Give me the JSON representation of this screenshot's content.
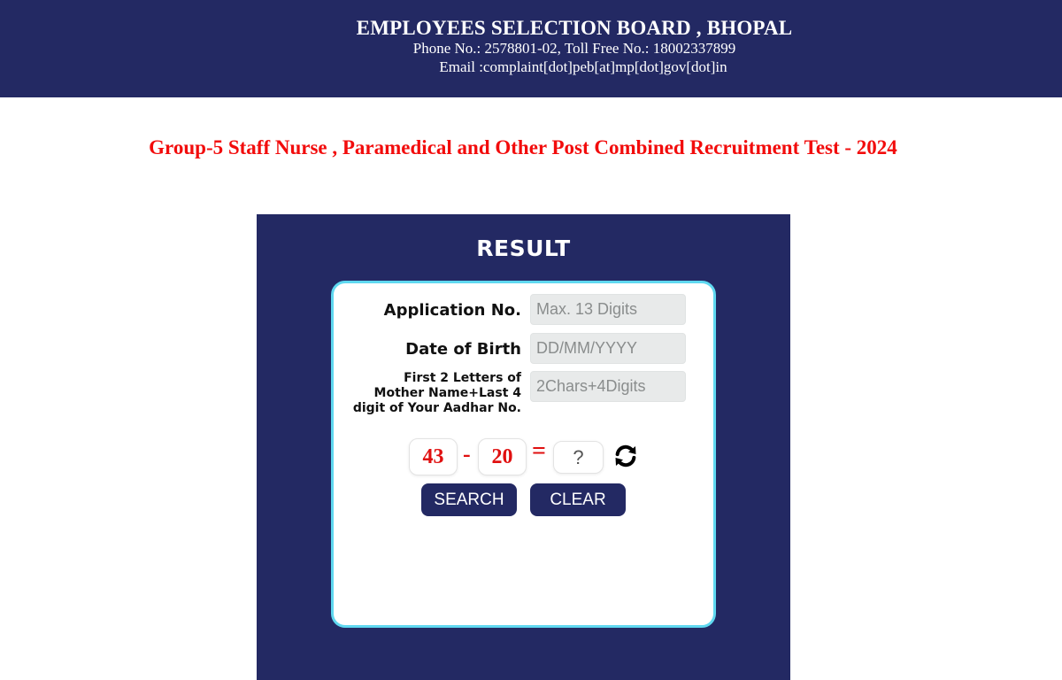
{
  "header": {
    "org_name": "EMPLOYEES SELECTION BOARD , BHOPAL",
    "phone_line": "Phone No.: 2578801-02, Toll Free No.: 18002337899",
    "email_line": "Email :complaint[dot]peb[at]mp[dot]gov[dot]in"
  },
  "exam_title": "Group-5 Staff Nurse , Paramedical and Other Post Combined Recruitment Test - 2024",
  "result_panel": {
    "title": "RESULT",
    "fields": {
      "application": {
        "label": "Application No.",
        "placeholder": "Max. 13 Digits",
        "value": ""
      },
      "dob": {
        "label": "Date of Birth",
        "placeholder": "DD/MM/YYYY",
        "value": ""
      },
      "mother": {
        "label": "First 2 Letters of Mother Name+Last 4 digit of Your Aadhar No.",
        "placeholder": "2Chars+4Digits",
        "value": ""
      }
    },
    "captcha": {
      "operand_a": "43",
      "operator": "-",
      "operand_b": "20",
      "equals": "=",
      "answer_placeholder": "?",
      "refresh_icon": "refresh-icon"
    },
    "buttons": {
      "search": "SEARCH",
      "clear": "CLEAR"
    }
  },
  "colors": {
    "navy": "#232963",
    "title_red": "#f20c0c",
    "card_border": "#5fd8f0",
    "captcha_red": "#e01010"
  }
}
